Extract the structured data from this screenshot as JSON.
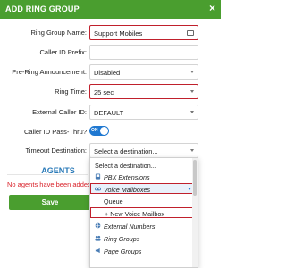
{
  "header": {
    "title": "ADD RING GROUP",
    "close": "×"
  },
  "form": {
    "ring_group_name": {
      "label": "Ring Group Name:",
      "value": "Support Mobiles"
    },
    "caller_id_prefix": {
      "label": "Caller ID Prefix:",
      "value": ""
    },
    "pre_ring": {
      "label": "Pre-Ring Announcement:",
      "value": "Disabled"
    },
    "ring_time": {
      "label": "Ring Time:",
      "value": "25 sec"
    },
    "external_caller_id": {
      "label": "External Caller ID:",
      "value": "DEFAULT"
    },
    "pass_thru": {
      "label": "Caller ID Pass-Thru?",
      "toggle": "ON"
    },
    "timeout_destination": {
      "label": "Timeout Destination:",
      "value": "Select a destination..."
    }
  },
  "agents": {
    "title": "AGENTS",
    "empty_text": "No agents have been added"
  },
  "save_label": "Save",
  "dropdown": {
    "items": [
      {
        "text": "Select a destination..."
      },
      {
        "text": "PBX Extensions"
      },
      {
        "text": "Voice Mailboxes"
      },
      {
        "text": "Queue"
      },
      {
        "text": "+ New Voice Mailbox"
      },
      {
        "text": "External Numbers"
      },
      {
        "text": "Ring Groups"
      },
      {
        "text": "Page Groups"
      }
    ]
  },
  "colors": {
    "header": "#4a9e2f",
    "accent": "#1f78d1",
    "highlight": "#c0202c"
  }
}
